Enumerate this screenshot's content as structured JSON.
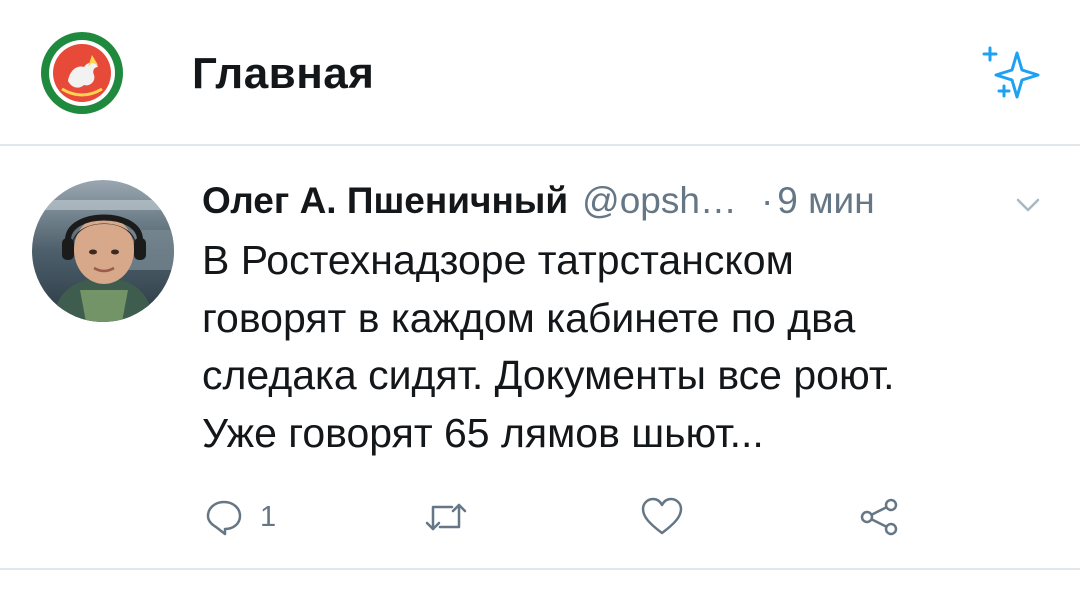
{
  "header": {
    "title": "Главная",
    "logo_icon": "tatarstan-emblem-icon",
    "sparkle_icon": "timeline-sparkle-icon"
  },
  "tweet": {
    "author_name": "Олег А. Пшеничный",
    "author_handle": "@opsh…",
    "separator": "·",
    "time": "9 мин",
    "text": "В Ростехнадзоре татрстанском\nговорят в каждом кабинете по два\nследака сидят. Документы все  роют.\nУже говорят 65 лямов шьют...",
    "actions": {
      "reply_count": "1",
      "icons": [
        "reply-icon",
        "retweet-icon",
        "like-icon",
        "share-icon"
      ]
    }
  },
  "colors": {
    "accent": "#1da1f2",
    "text": "#14171a",
    "secondary": "#657786",
    "divider": "#e1e8ed",
    "emblem_green": "#1f8a3e",
    "emblem_red": "#d32f2f"
  }
}
